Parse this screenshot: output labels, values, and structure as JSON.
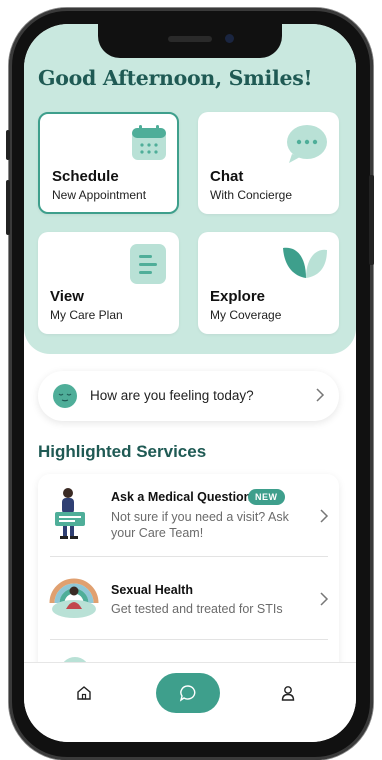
{
  "greeting": "Good Afternoon, Smiles!",
  "quick_actions": [
    {
      "title": "Schedule",
      "subtitle": "New Appointment",
      "icon": "calendar-icon",
      "selected": true
    },
    {
      "title": "Chat",
      "subtitle": "With Concierge",
      "icon": "chat-bubble-icon"
    },
    {
      "title": "View",
      "subtitle": "My Care Plan",
      "icon": "document-lines-icon"
    },
    {
      "title": "Explore",
      "subtitle": "My Coverage",
      "icon": "brand-leaf-icon"
    }
  ],
  "mood_prompt": {
    "text": "How are you feeling today?",
    "icon": "calm-face-icon"
  },
  "section_title": "Highlighted Services",
  "services": [
    {
      "name": "Ask a Medical Question",
      "badge": "NEW",
      "description": "Not sure if you need a visit? Ask your Care Team!"
    },
    {
      "name": "Sexual Health",
      "description": "Get tested and treated for STIs"
    }
  ],
  "nav": {
    "home": "home-icon",
    "chat": "chat-icon",
    "profile": "profile-icon"
  },
  "colors": {
    "accent": "#3e9f8c",
    "hero_bg": "#c9e8df",
    "heading": "#1f5a54"
  }
}
